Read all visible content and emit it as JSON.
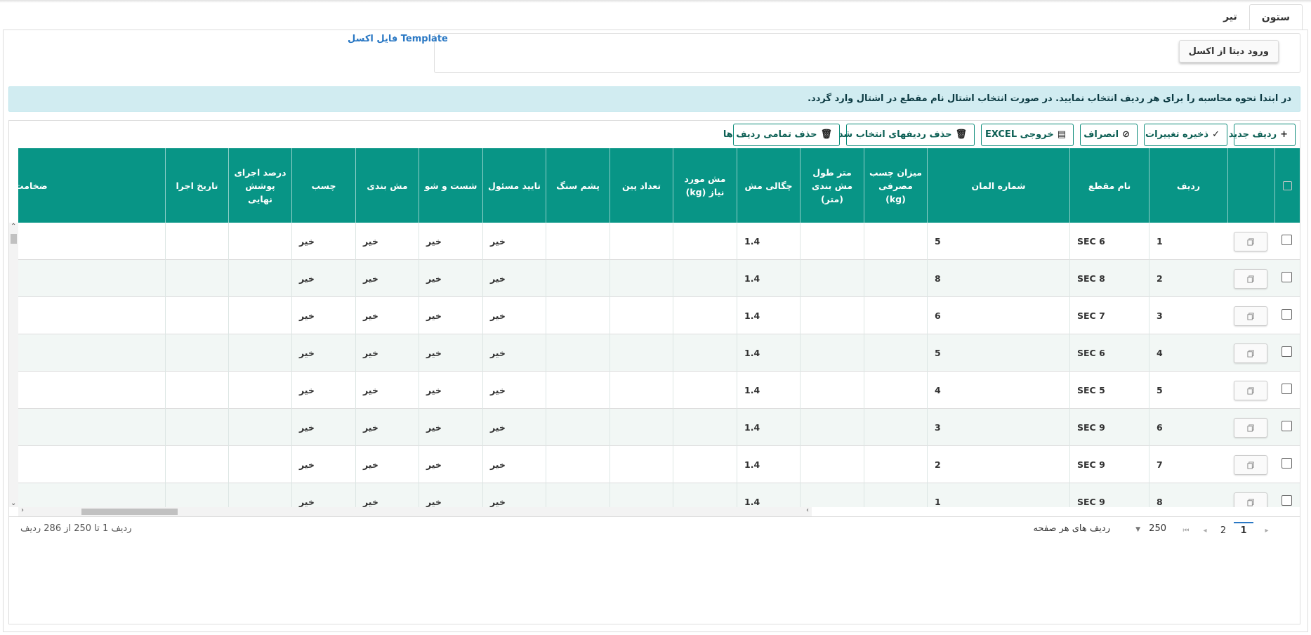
{
  "tabs": [
    {
      "label": "ستون",
      "active": true
    },
    {
      "label": "تیر",
      "active": false
    }
  ],
  "import": {
    "button_label": "ورود دیتا از اکسل",
    "template_link": "Template فایل اکسل"
  },
  "info_message": "در ابتدا نحوه محاسبه را برای هر ردیف انتخاب نمایید. در صورت انتخاب اشتال نام مقطع در اشتال وارد گردد.",
  "toolbar": {
    "new_row": "ردیف جدید",
    "save": "ذخیره تغییرات",
    "cancel": "انصراف",
    "excel": "خروجی EXCEL",
    "delete_selected": "حذف ردیفهای انتخاب شده",
    "delete_all": "حذف تمامی ردیف ها"
  },
  "columns": [
    "ردیف",
    "نام مقطع",
    "شماره المان",
    "میزان چسب مصرفی (kg)",
    "متر طول مش بندی (متر)",
    "چگالی مش",
    "مش مورد نیاز (kg)",
    "تعداد پین",
    "پشم سنگ",
    "تایید مسئول",
    "شست و شو",
    "مش بندی",
    "چسب",
    "درصد اجرای پوشش نهایی",
    "تاریخ اجرا",
    "ضخامت"
  ],
  "rows": [
    {
      "no": "1",
      "section": "SEC 6",
      "element": "5",
      "density": "1.4",
      "approve": "خیر",
      "wash": "خیر",
      "mesh": "خیر",
      "glue": "خیر"
    },
    {
      "no": "2",
      "section": "SEC 8",
      "element": "8",
      "density": "1.4",
      "approve": "خیر",
      "wash": "خیر",
      "mesh": "خیر",
      "glue": "خیر"
    },
    {
      "no": "3",
      "section": "SEC 7",
      "element": "6",
      "density": "1.4",
      "approve": "خیر",
      "wash": "خیر",
      "mesh": "خیر",
      "glue": "خیر"
    },
    {
      "no": "4",
      "section": "SEC 6",
      "element": "5",
      "density": "1.4",
      "approve": "خیر",
      "wash": "خیر",
      "mesh": "خیر",
      "glue": "خیر"
    },
    {
      "no": "5",
      "section": "SEC 5",
      "element": "4",
      "density": "1.4",
      "approve": "خیر",
      "wash": "خیر",
      "mesh": "خیر",
      "glue": "خیر"
    },
    {
      "no": "6",
      "section": "SEC 9",
      "element": "3",
      "density": "1.4",
      "approve": "خیر",
      "wash": "خیر",
      "mesh": "خیر",
      "glue": "خیر"
    },
    {
      "no": "7",
      "section": "SEC 9",
      "element": "2",
      "density": "1.4",
      "approve": "خیر",
      "wash": "خیر",
      "mesh": "خیر",
      "glue": "خیر"
    },
    {
      "no": "8",
      "section": "SEC 9",
      "element": "1",
      "density": "1.4",
      "approve": "خیر",
      "wash": "خیر",
      "mesh": "خیر",
      "glue": "خیر"
    }
  ],
  "pager": {
    "pages": [
      "1",
      "2"
    ],
    "current": "1",
    "page_size": "250",
    "page_size_label": "ردیف های هر صفحه",
    "info": "ردیف 1 تا 250 از 286 ردیف"
  },
  "colors": {
    "header_bg": "#089586",
    "info_bg": "#d1ecf1",
    "link": "#2a78c4"
  }
}
